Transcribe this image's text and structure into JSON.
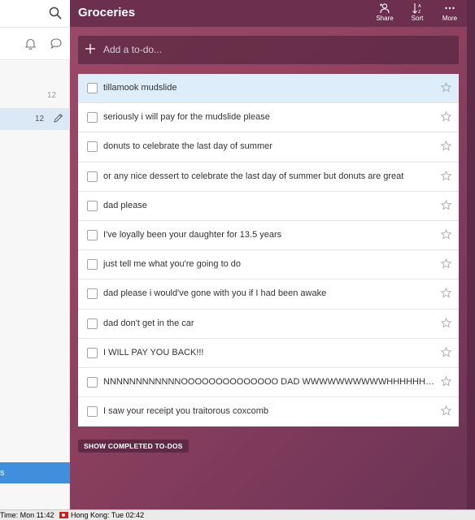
{
  "sidebar": {
    "count_inbox": "12",
    "count_active": "12",
    "bottom_label": "s"
  },
  "header": {
    "title": "Groceries",
    "share_label": "Share",
    "sort_label": "Sort",
    "more_label": "More"
  },
  "add_todo": {
    "placeholder": "Add a to-do..."
  },
  "todos": [
    {
      "text": "tillamook mudslide",
      "selected": true
    },
    {
      "text": "seriously i will pay for the mudslide please"
    },
    {
      "text": "donuts to celebrate the last day of summer"
    },
    {
      "text": "or any nice dessert to celebrate the last day of summer but donuts are great"
    },
    {
      "text": "dad please"
    },
    {
      "text": "I've loyally been your daughter for 13.5 years"
    },
    {
      "text": "just tell me what you're going to do"
    },
    {
      "text": "dad please i would've gone with you if I had been awake"
    },
    {
      "text": "dad don't get in the car"
    },
    {
      "text": "I WILL PAY YOU BACK!!!"
    },
    {
      "text": "NNNNNNNNNNNNOOOOOOOOOOOOOO DAD WWWWWWWWWWHHHHHHHHY"
    },
    {
      "text": "I saw your receipt you traitorous coxcomb"
    }
  ],
  "show_completed_label": "SHOW COMPLETED TO-DOS",
  "taskbar": {
    "time_local": "Time: Mon 11:42",
    "time_hk": "Hong Kong: Tue 02:42"
  },
  "colors": {
    "header_bg": "#6d2f4e",
    "selected_row": "#deedfa",
    "sidebar_highlight": "#3f8fdc"
  }
}
